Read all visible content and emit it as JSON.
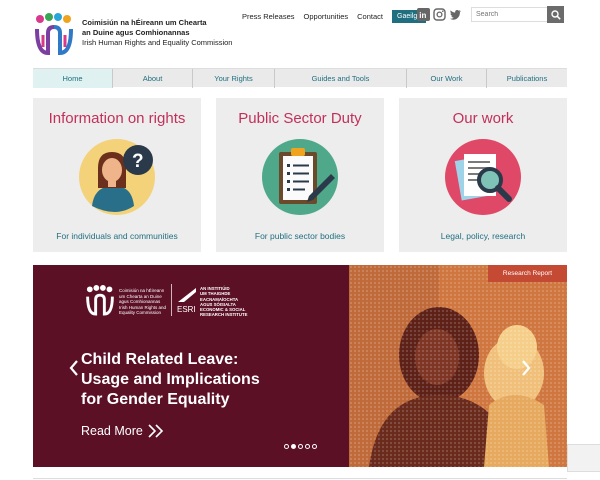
{
  "header": {
    "org_name_ga_line1": "Coimisiún na hÉireann um Chearta",
    "org_name_ga_line2": "an Duine agus Comhionannas",
    "org_name_en": "Irish Human Rights and Equality Commission",
    "logo_icon": "ihrec-logo-icon"
  },
  "topnav": {
    "links": [
      "Press Releases",
      "Opportunities",
      "Contact"
    ],
    "language_button": "Gaeilge",
    "social_icons": [
      "linkedin-icon",
      "instagram-icon",
      "twitter-icon"
    ],
    "search_placeholder": "Search"
  },
  "mainnav": {
    "items": [
      "Home",
      "About",
      "Your Rights",
      "Guides and Tools",
      "Our Work",
      "Publications"
    ],
    "active": "Home"
  },
  "cards": [
    {
      "title": "Information on rights",
      "subtitle": "For individuals and communities",
      "icon": "person-question-icon"
    },
    {
      "title": "Public Sector Duty",
      "subtitle": "For public sector bodies",
      "icon": "clipboard-checklist-icon"
    },
    {
      "title": "Our work",
      "subtitle": "Legal, policy, research",
      "icon": "document-magnifier-icon"
    }
  ],
  "hero": {
    "badge": "Research Report",
    "title_lines": [
      "Child Related Leave:",
      "Usage and Implications",
      "for Gender Equality"
    ],
    "read_more": "Read More",
    "partner1": [
      "Coimisiún na hÉireann",
      "um Chearta an Duine",
      "agus Comhionannas",
      "Irish Human Rights and",
      "Equality Commission"
    ],
    "partner2": [
      "AN INSTITIÚID",
      "UM THAIGHDE",
      "EACNAMAÍOCHTA",
      "AGUS SÓISIALTA",
      "ECONOMIC & SOCIAL",
      "RESEARCH INSTITUTE"
    ],
    "partner2_mark": "ESRI",
    "slides_total": 5,
    "slide_active": 2
  },
  "colors": {
    "accent_teal": "#1f6f80",
    "title_pink": "#c2305a",
    "hero_bg": "#5b1026",
    "badge_orange": "#c44a34"
  }
}
